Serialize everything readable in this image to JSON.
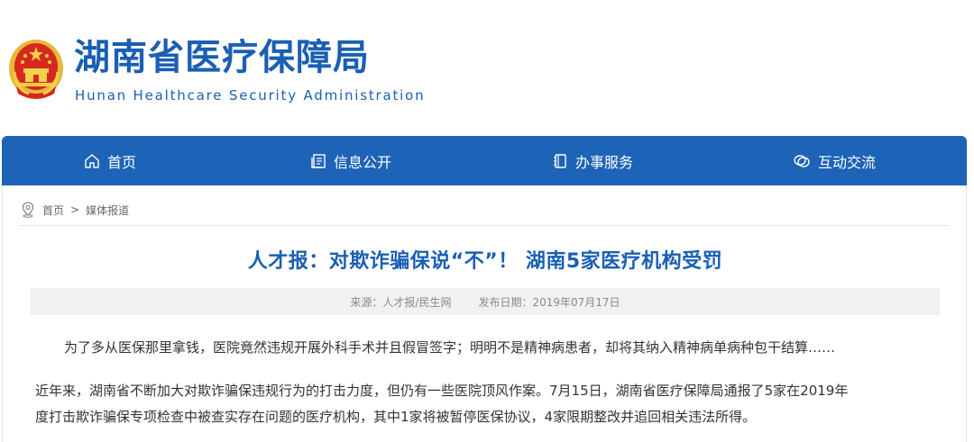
{
  "site": {
    "title": "湖南省医疗保障局",
    "subtitle": "Hunan Healthcare Security Administration"
  },
  "nav": [
    {
      "label": "首页",
      "icon": "home-icon"
    },
    {
      "label": "信息公开",
      "icon": "document-icon"
    },
    {
      "label": "办事服务",
      "icon": "book-icon"
    },
    {
      "label": "互动交流",
      "icon": "chat-icon"
    }
  ],
  "breadcrumb": {
    "home": "首页",
    "separator": ">",
    "current": "媒体报道"
  },
  "article": {
    "title": "人才报：对欺诈骗保说“不”！ 湖南5家医疗机构受罚",
    "source": "来源：人才报/民生网",
    "date": "发布日期：2019年07月17日",
    "paragraphs": [
      "为了多从医保那里拿钱，医院竟然违规开展外科手术并且假冒签字；明明不是精神病患者，却将其纳入精神病单病种包干结算……",
      "近年来，湖南省不断加大对欺诈骗保违规行为的打击力度，但仍有一些医院顶风作案。7月15日，湖南省医疗保障局通报了5家在2019年",
      "度打击欺诈骗保专项检查中被查实存在问题的医疗机构，其中1家将被暂停医保协议，4家限期整改并追回相关违法所得。"
    ]
  },
  "colors": {
    "brand": "#1a5fb4",
    "nav_bg": "#1d63b8",
    "meta_bg": "#f1f1f1"
  }
}
